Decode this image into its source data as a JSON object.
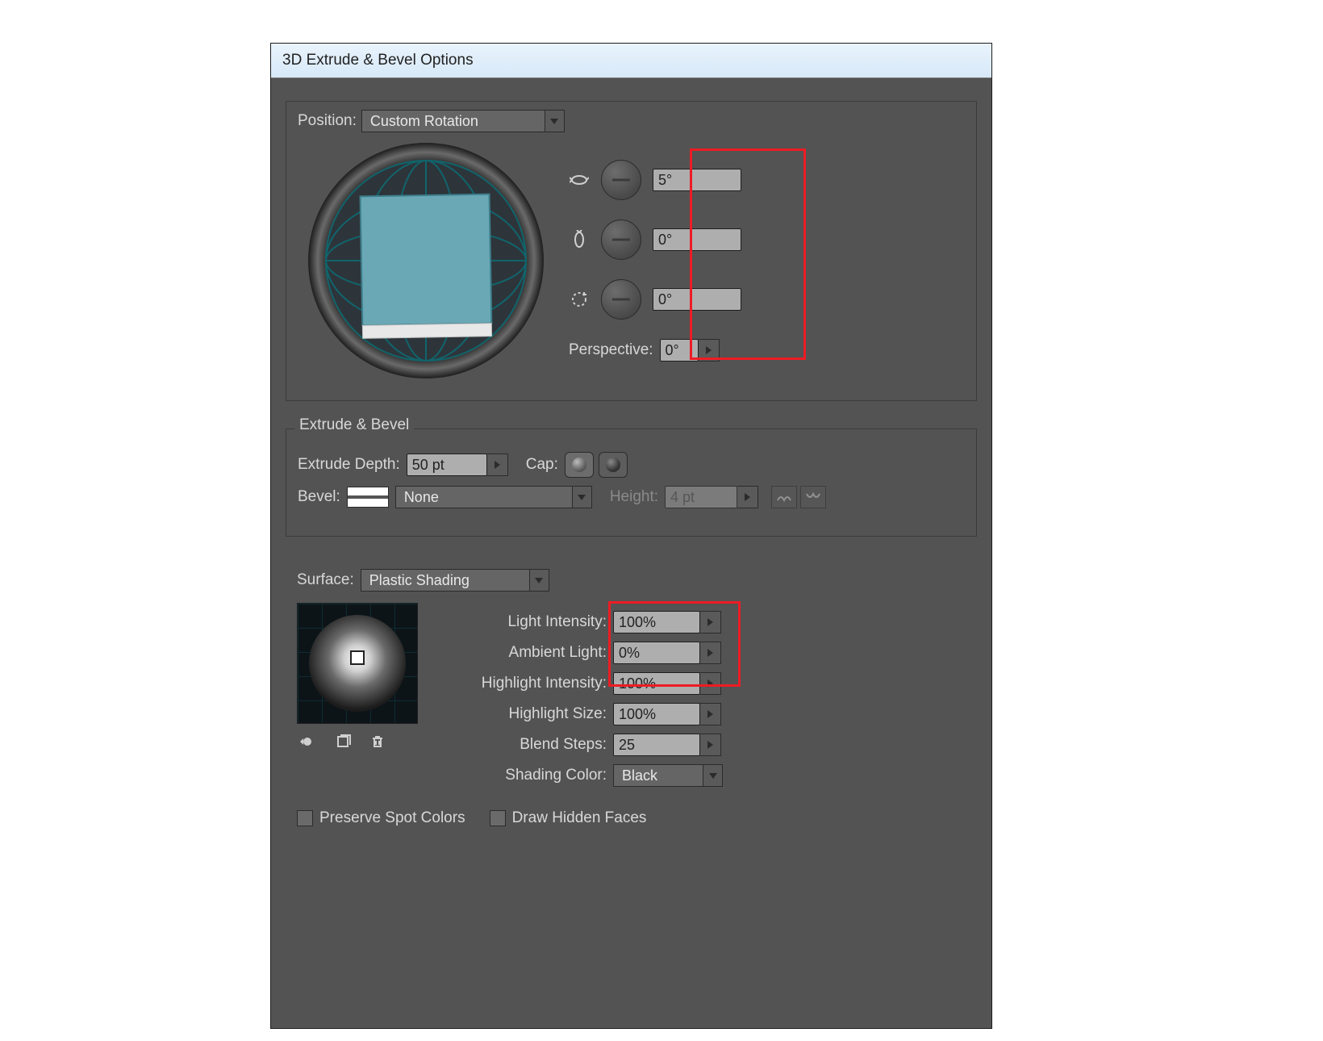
{
  "window_title": "3D Extrude & Bevel Options",
  "position": {
    "label": "Position:",
    "value": "Custom Rotation",
    "x_angle": "5°",
    "y_angle": "0°",
    "z_angle": "0°",
    "perspective_label": "Perspective:",
    "perspective_value": "0°"
  },
  "extrude": {
    "legend": "Extrude & Bevel",
    "depth_label": "Extrude Depth:",
    "depth_value": "50 pt",
    "cap_label": "Cap:",
    "bevel_label": "Bevel:",
    "bevel_value": "None",
    "height_label": "Height:",
    "height_value": "4 pt"
  },
  "surface": {
    "label": "Surface:",
    "value": "Plastic Shading",
    "light_intensity_label": "Light Intensity:",
    "light_intensity_value": "100%",
    "ambient_light_label": "Ambient Light:",
    "ambient_light_value": "0%",
    "highlight_intensity_label": "Highlight Intensity:",
    "highlight_intensity_value": "100%",
    "highlight_size_label": "Highlight Size:",
    "highlight_size_value": "100%",
    "blend_steps_label": "Blend Steps:",
    "blend_steps_value": "25",
    "shading_color_label": "Shading Color:",
    "shading_color_value": "Black",
    "preserve_spot_label": "Preserve Spot Colors",
    "draw_hidden_label": "Draw Hidden Faces"
  }
}
